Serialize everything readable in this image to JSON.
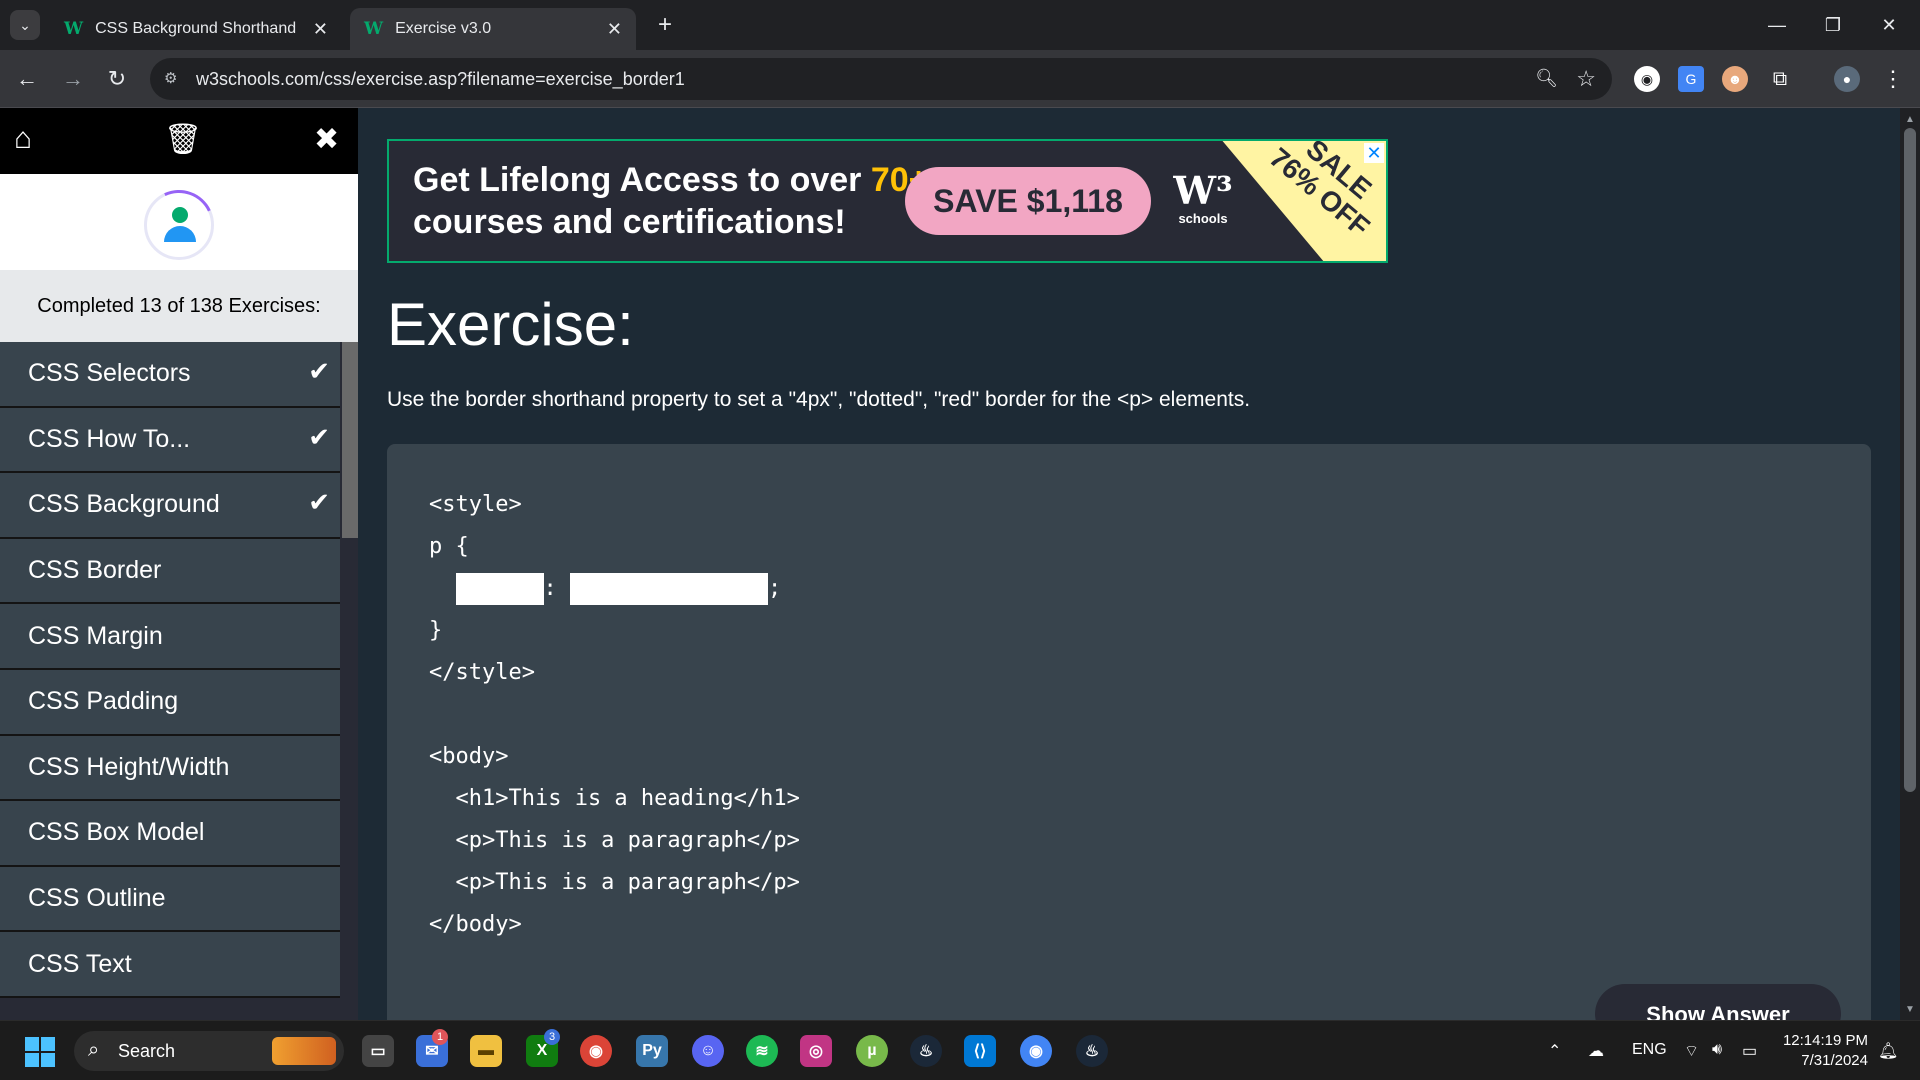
{
  "browser": {
    "tabs": [
      {
        "label": "CSS Background Shorthand",
        "favicon": "W"
      },
      {
        "label": "Exercise v3.0",
        "favicon": "W"
      }
    ],
    "url": "w3schools.com/css/exercise.asp?filename=exercise_border1"
  },
  "sidebar": {
    "progress_text": "Completed 13 of 138 Exercises:",
    "items": [
      {
        "label": "CSS Selectors",
        "done": true
      },
      {
        "label": "CSS How To...",
        "done": true
      },
      {
        "label": "CSS Background",
        "done": true
      },
      {
        "label": "CSS Border",
        "done": false
      },
      {
        "label": "CSS Margin",
        "done": false
      },
      {
        "label": "CSS Padding",
        "done": false
      },
      {
        "label": "CSS Height/Width",
        "done": false
      },
      {
        "label": "CSS Box Model",
        "done": false
      },
      {
        "label": "CSS Outline",
        "done": false
      },
      {
        "label": "CSS Text",
        "done": false
      }
    ],
    "check_glyph": "✔"
  },
  "ad": {
    "line1": "Get Lifelong Access to over ",
    "line1_accent": "70+",
    "line2": "courses and certifications!",
    "save": "SAVE $1,118",
    "logo_mark": "W³",
    "logo_text": "schools",
    "sale_line1": "SALE",
    "sale_line2": "76% OFF",
    "colors": {
      "bg": "#282a35",
      "accent": "#ffc107",
      "save_bg": "#f2a6c3",
      "banner": "#fff4a3",
      "border": "#04aa6d"
    }
  },
  "exercise": {
    "title": "Exercise:",
    "description": "Use the border shorthand property to set a \"4px\", \"dotted\", \"red\" border for the <p> elements.",
    "code": {
      "l1": "<style>",
      "l2": "p {",
      "l3_sep": ":",
      "l3_end": ";",
      "l4": "}",
      "l5": "</style>",
      "l6": "<body>",
      "l7": "  <h1>This is a heading</h1>",
      "l8": "  <p>This is a paragraph</p>",
      "l9": "  <p>This is a paragraph</p>",
      "l10": "</body>"
    },
    "show_answer": "Show Answer"
  },
  "taskbar": {
    "search_label": "Search",
    "lang": "ENG",
    "time": "12:14:19 PM",
    "date": "7/31/2024",
    "badges": {
      "mail": "1",
      "xbox": "3"
    }
  }
}
